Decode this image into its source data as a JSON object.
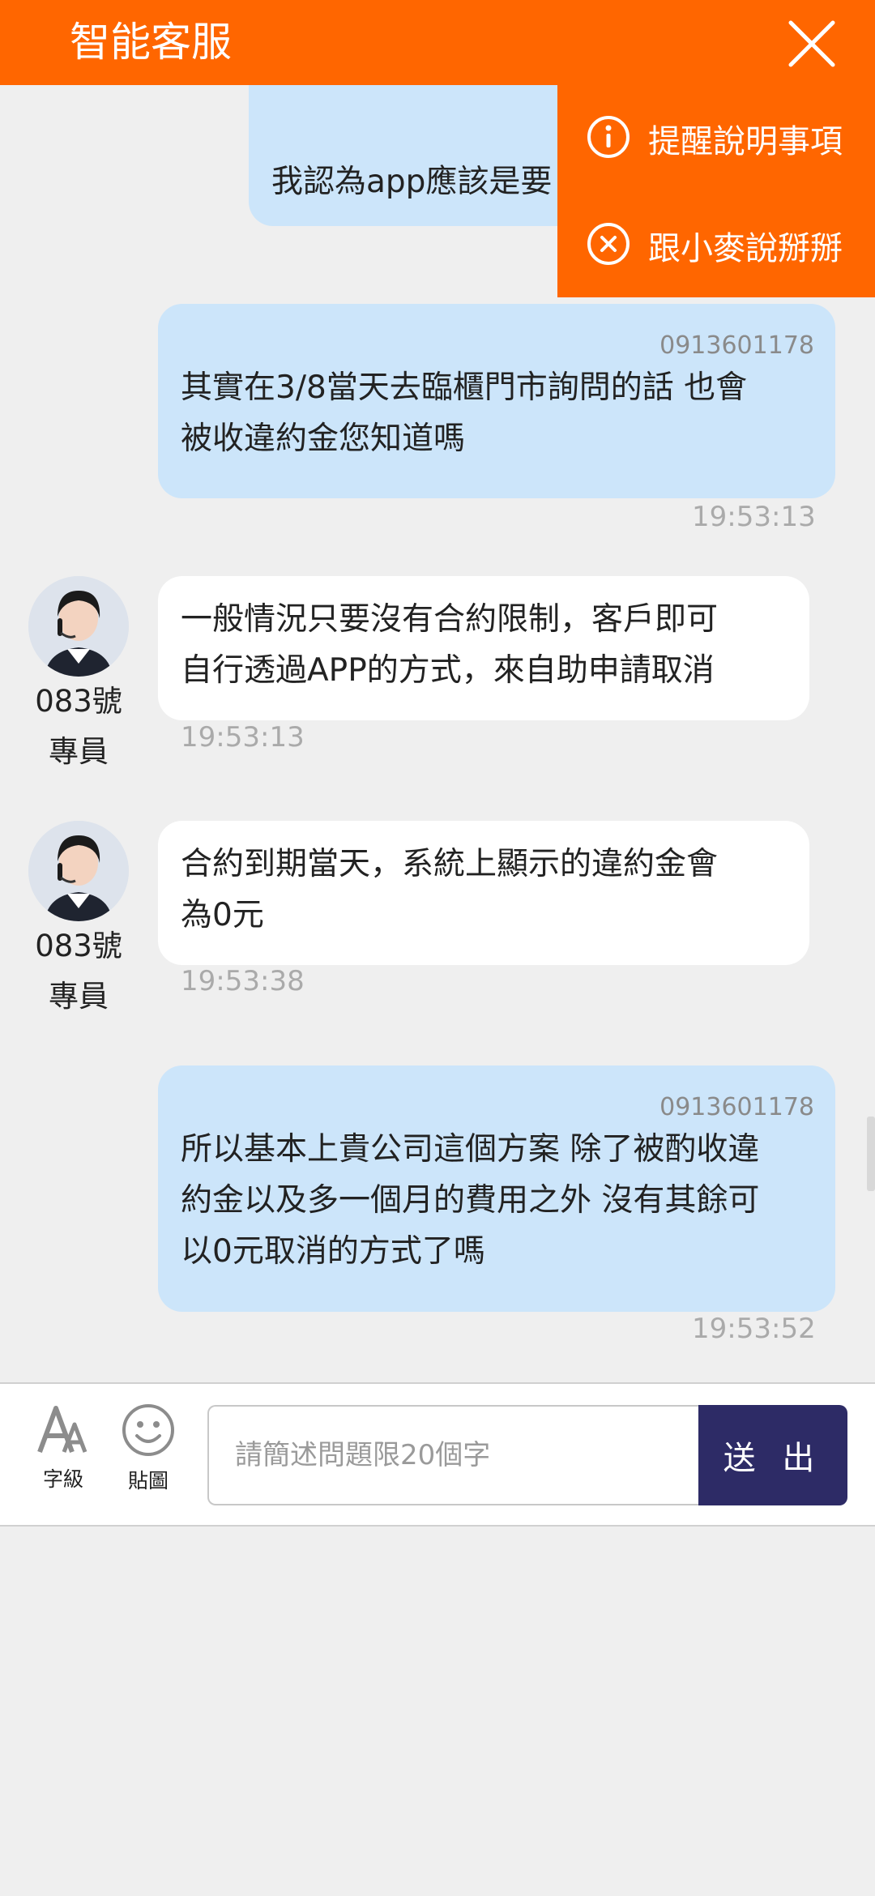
{
  "header": {
    "title": "智能客服"
  },
  "popup": {
    "items": [
      {
        "label": "提醒說明事項",
        "icon": "info-icon"
      },
      {
        "label": "跟小麥說掰掰",
        "icon": "close-circle-icon"
      }
    ]
  },
  "messages": [
    {
      "from": "user",
      "text": "我認為app應該是要"
    },
    {
      "from": "user",
      "phone": "0913601178",
      "lines": [
        "其實在3/8當天去臨櫃門市詢問的話 也會",
        "被收違約金您知道嗎"
      ],
      "time": "19:53:13"
    },
    {
      "from": "agent",
      "agent_name": [
        "083號",
        "專員"
      ],
      "lines": [
        "一般情況只要沒有合約限制，客戶即可",
        "自行透過APP的方式，來自助申請取消"
      ],
      "time": "19:53:13"
    },
    {
      "from": "agent",
      "agent_name": [
        "083號",
        "專員"
      ],
      "lines": [
        "合約到期當天，系統上顯示的違約金會",
        "為0元"
      ],
      "time": "19:53:38"
    },
    {
      "from": "user",
      "phone": "0913601178",
      "lines": [
        "所以基本上貴公司這個方案 除了被酌收違",
        "約金以及多一個月的費用之外 沒有其餘可",
        "以0元取消的方式了嗎"
      ],
      "time": "19:53:52"
    }
  ],
  "footer": {
    "font_size_label": "字級",
    "sticker_label": "貼圖",
    "input_placeholder": "請簡述問題限20個字",
    "send_label": "送 出"
  },
  "colors": {
    "brand": "#ff6600",
    "user_bubble": "#cce5fa",
    "send_button": "#2d2b66"
  }
}
